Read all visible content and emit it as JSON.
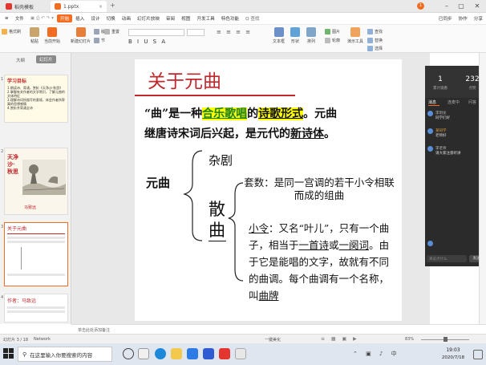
{
  "titlebar": {
    "tabs": [
      {
        "label": "稻壳模板",
        "color": "#e2362e"
      },
      {
        "label": "1.pptx",
        "color": "#f26d21"
      }
    ],
    "new_tab": "+",
    "page_badge": "1"
  },
  "menubar": {
    "file": "文件",
    "items": [
      "开始",
      "插入",
      "设计",
      "切换",
      "动画",
      "幻灯片放映",
      "审阅",
      "视图",
      "开发工具",
      "特色功能"
    ],
    "search": "Q 查找",
    "right": [
      "已同步",
      "协作",
      "分享"
    ]
  },
  "ribbon": {
    "buttons": [
      "格式刷",
      "粘贴",
      "当前开始",
      "新建幻灯片",
      "版式",
      "节",
      "重置",
      "文本框",
      "形状",
      "排列",
      "轮廓",
      "图片",
      "演示工具",
      "替换",
      "查找",
      "选择"
    ]
  },
  "leftpanel": {
    "tabs": [
      "大纲",
      "幻灯片"
    ],
    "slides": [
      {
        "num": "1",
        "title": "学习目标",
        "lines": [
          "1.朗读诗、背诵，赏析《天净沙·秋思》",
          "2.掌握有关作者的文学常识，了解元曲的文体特征",
          "3.理解诗词所描写的意境，体会作者所寄寓的思想感情",
          "4.赏析并背诵全诗"
        ]
      },
      {
        "num": "2",
        "title": "天净沙·秋思",
        "author": "马致远"
      },
      {
        "num": "3",
        "title": "关于元曲"
      },
      {
        "num": "4",
        "title": "作者：马致远"
      }
    ]
  },
  "slide": {
    "title": "关于元曲",
    "intro_1": "“曲”是一种",
    "intro_hl1": "合乐歌唱",
    "intro_2": "的",
    "intro_hl2": "诗歌形式",
    "intro_3": "。元曲",
    "intro_line2_a": "继唐诗宋词后兴起，是元代的",
    "intro_line2_b": "新诗体",
    "intro_line2_c": "。",
    "yuanqu": "元曲",
    "zaju": "杂剧",
    "sanqu": "散曲",
    "taoshu": "套数：是同一宫调的若干小令相联而成的组曲",
    "xiaoling_label": "小令",
    "xiaoling_text_a": "：又名“叶儿”，只有一个曲子，相当于",
    "xiaoling_u1": "一首诗",
    "xiaoling_text_b": "或",
    "xiaoling_u2": "一阕词",
    "xiaoling_text_c": "。由于它是能唱的文字，故就有不同的曲调。每个曲调有一个名称，叫",
    "xiaoling_u3": "曲牌"
  },
  "rightpanel": {
    "stats": [
      {
        "value": "1",
        "label": "累计观看"
      },
      {
        "value": "232",
        "label": "点赞"
      }
    ],
    "tabs": [
      "消息",
      "连麦中",
      "问答"
    ],
    "messages": [
      {
        "name": "李玥龙",
        "text": "同学们好"
      },
      {
        "name": "某同学",
        "text": "老师好"
      },
      {
        "name": "李老师",
        "text": "请大家注意听讲"
      }
    ],
    "input_placeholder": "来说点什么",
    "send": "发送"
  },
  "notes": {
    "placeholder": "单击此处添加备注"
  },
  "statusbar": {
    "slide_info": "幻灯片 3 / 18",
    "theme": "Network",
    "beautify": "一键美化",
    "zoom": "83%"
  },
  "taskbar": {
    "search_placeholder": "在这里输入你要搜索的内容",
    "time": "19:03",
    "date": "2020/7/18"
  },
  "colors": {
    "accent": "#f26d21",
    "title_red": "#c0282d",
    "highlight": "#ffff00",
    "green": "#1a7f1a"
  }
}
